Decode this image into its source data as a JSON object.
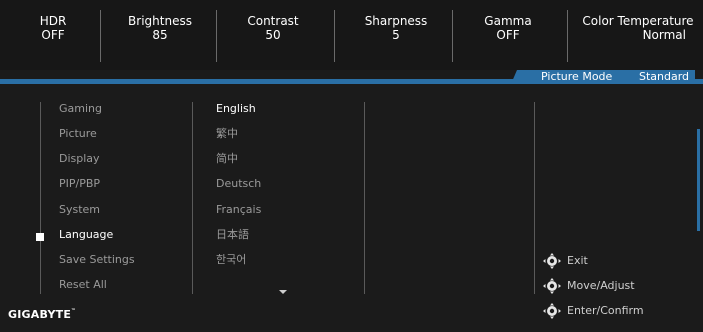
{
  "status": [
    {
      "label": "HDR",
      "value": "OFF"
    },
    {
      "label": "Brightness",
      "value": "85"
    },
    {
      "label": "Contrast",
      "value": "50"
    },
    {
      "label": "Sharpness",
      "value": "5"
    },
    {
      "label": "Gamma",
      "value": "OFF"
    },
    {
      "label": "Color Temperature",
      "value": "Normal"
    }
  ],
  "picture_mode": {
    "label": "Picture Mode",
    "value": "Standard"
  },
  "menu": {
    "items": [
      "Gaming",
      "Picture",
      "Display",
      "PIP/PBP",
      "System",
      "Language",
      "Save Settings",
      "Reset All"
    ],
    "selected": "Language"
  },
  "language": {
    "items": [
      "English",
      "繁中",
      "简中",
      "Deutsch",
      "Français",
      "日本語",
      "한국어"
    ],
    "selected": "English"
  },
  "hints": [
    {
      "icon": "joystick-icon",
      "label": "Exit"
    },
    {
      "icon": "joystick-icon",
      "label": "Move/Adjust"
    },
    {
      "icon": "joystick-icon",
      "label": "Enter/Confirm"
    }
  ],
  "brand": {
    "name": "GIGABYTE",
    "mark": "™"
  },
  "colors": {
    "accent": "#2a6fa5",
    "background": "#1b1b1b",
    "inactive_text": "#9a9a9a"
  }
}
